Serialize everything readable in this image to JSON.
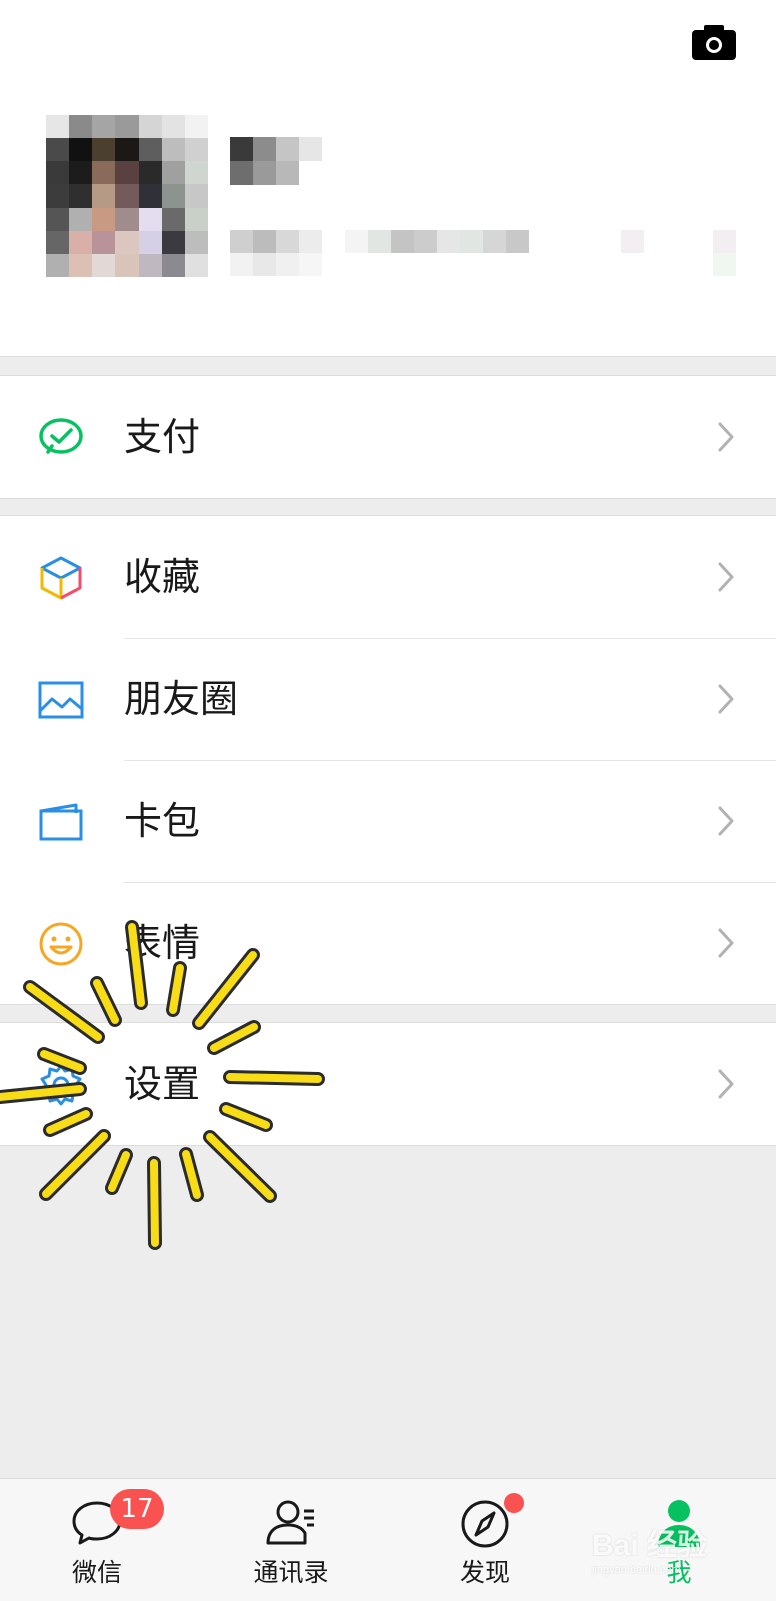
{
  "profile": {
    "camera_icon": "camera-icon"
  },
  "menu": {
    "pay": {
      "label": "支付",
      "icon": "wechat-pay-icon"
    },
    "favorites": {
      "label": "收藏",
      "icon": "favorites-cube-icon"
    },
    "moments": {
      "label": "朋友圈",
      "icon": "moments-photo-icon"
    },
    "cards": {
      "label": "卡包",
      "icon": "card-wallet-icon"
    },
    "stickers": {
      "label": "表情",
      "icon": "smiley-icon"
    },
    "settings": {
      "label": "设置",
      "icon": "gear-icon"
    }
  },
  "tabbar": {
    "tabs": [
      {
        "label": "微信",
        "icon": "chat-bubble-icon",
        "badge": "17"
      },
      {
        "label": "通讯录",
        "icon": "contacts-icon"
      },
      {
        "label": "发现",
        "icon": "compass-icon"
      },
      {
        "label": "我",
        "icon": "me-person-icon",
        "active": true
      }
    ]
  },
  "watermark": {
    "text": "Bai 经验",
    "sub": "jingyan.baidu.com"
  },
  "colors": {
    "accent": "#07c160",
    "badge": "#fa5151",
    "background": "#ededed",
    "highlight_burst": "#f7dc16"
  }
}
